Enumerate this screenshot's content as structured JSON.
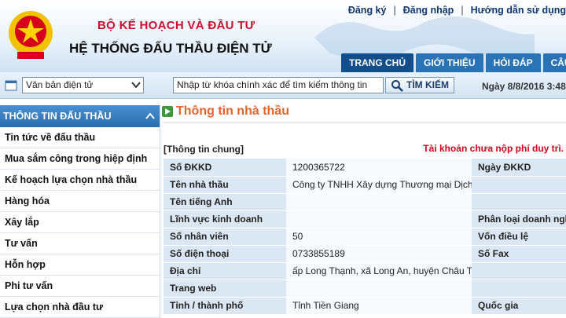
{
  "header": {
    "ministry": "BỘ KẾ HOẠCH VÀ ĐẦU TƯ",
    "system_title": "HỆ THỐNG ĐẤU THẦU ĐIỆN TỬ",
    "links": [
      "Đăng ký",
      "Đăng nhập",
      "Hướng dẫn sử dụng"
    ],
    "nav": [
      {
        "label": "TRANG CHỦ",
        "active": true
      },
      {
        "label": "GIỚI THIỆU",
        "active": false
      },
      {
        "label": "HỎI ĐÁP",
        "active": false
      },
      {
        "label": "CÂU HỎI",
        "active": false
      }
    ],
    "accent_color": "#c8102e"
  },
  "searchbar": {
    "doc_type_selected": "Văn bản điện tử",
    "search_placeholder": "Nhập từ khóa chính xác để tìm kiếm thông tin",
    "search_button": "TÌM KIẾM",
    "date": "Ngày 8/8/2016 3:48"
  },
  "sidebar": {
    "header": "THÔNG TIN ĐẤU THẦU",
    "items": [
      "Tin tức về đấu thầu",
      "Mua sắm công trong hiệp định",
      "Kế hoạch lựa chọn nhà thầu",
      "Hàng hóa",
      "Xây lắp",
      "Tư vấn",
      "Hỗn hợp",
      "Phi tư vấn",
      "Lựa chọn nhà đầu tư"
    ]
  },
  "main": {
    "title": "Thông tin nhà thầu",
    "section_label": "[Thông tin chung]",
    "warning": "Tài khoản chưa nộp phí duy trì.",
    "rows": [
      {
        "label": "Số ĐKKD",
        "value": "1200365722",
        "label2": "Ngày ĐKKD"
      },
      {
        "label": "Tên nhà thầu",
        "value": "Công ty TNHH Xây dựng Thương mại Dịch vụ Hữu Lợi",
        "label2": ""
      },
      {
        "label": "Tên tiếng Anh",
        "value": "",
        "label2": ""
      },
      {
        "label": "Lĩnh vực kinh doanh",
        "value": "",
        "label2": "Phân loại doanh nghiệp"
      },
      {
        "label": "Số nhân viên",
        "value": "50",
        "label2": "Vốn điều lệ"
      },
      {
        "label": "Số điện thoại",
        "value": "0733855189",
        "label2": "Số Fax"
      },
      {
        "label": "Địa chỉ",
        "value": "ấp Long Thạnh, xã Long An, huyện Châu Thành, tỉnh Tiền Giang",
        "label2": ""
      },
      {
        "label": "Trang web",
        "value": "",
        "label2": ""
      },
      {
        "label": "Tỉnh / thành phố",
        "value": "Tỉnh Tiền Giang",
        "label2": "Quốc gia"
      }
    ]
  }
}
